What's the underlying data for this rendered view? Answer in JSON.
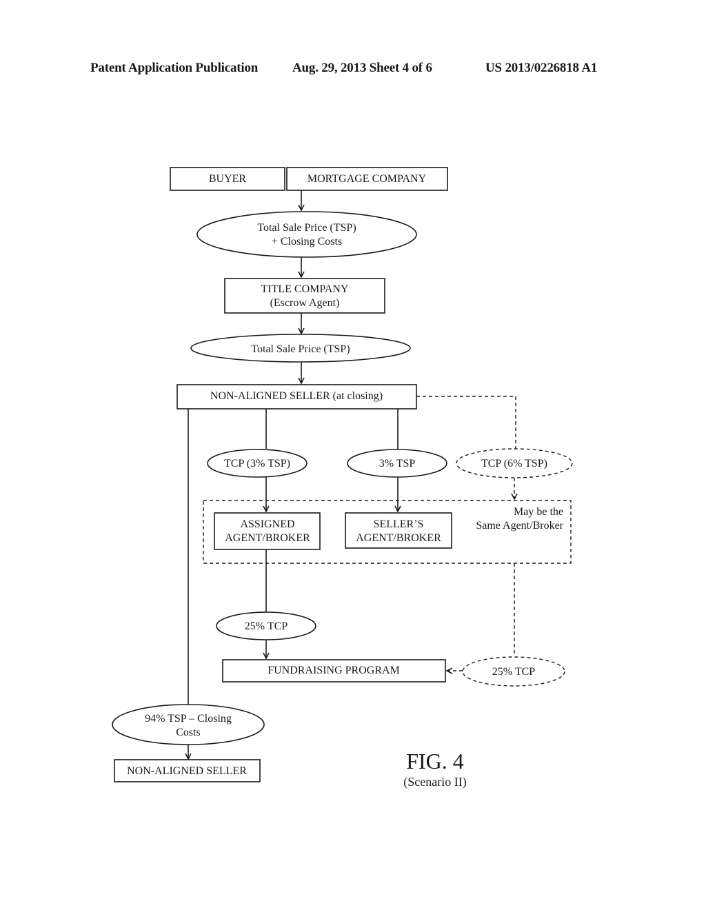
{
  "header": {
    "publication": "Patent Application Publication",
    "date_sheet": "Aug. 29, 2013  Sheet 4 of 6",
    "patent_number": "US 2013/0226818 A1"
  },
  "diagram": {
    "nodes": {
      "buyer": "BUYER",
      "mortgage_company": "MORTGAGE COMPANY",
      "tsp_closing": [
        "Total Sale Price (TSP)",
        "+ Closing Costs"
      ],
      "title_company": [
        "TITLE COMPANY",
        "(Escrow Agent)"
      ],
      "tsp": "Total Sale Price (TSP)",
      "non_aligned_seller_closing": "NON-ALIGNED SELLER (at closing)",
      "tcp_3": "TCP (3% TSP)",
      "tsp_3": "3% TSP",
      "tcp_6": "TCP (6% TSP)",
      "assigned_agent": [
        "ASSIGNED",
        "AGENT/BROKER"
      ],
      "sellers_agent": [
        "SELLER’S",
        "AGENT/BROKER"
      ],
      "same_agent_note": [
        "May be the",
        "Same Agent/Broker"
      ],
      "tcp_25_left": "25% TCP",
      "fundraising": "FUNDRAISING PROGRAM",
      "tcp_25_right": "25% TCP",
      "tsp_94": [
        "94% TSP – Closing",
        "Costs"
      ],
      "non_aligned_seller": "NON-ALIGNED SELLER"
    },
    "caption": {
      "figure": "FIG. 4",
      "scenario": "(Scenario II)"
    }
  }
}
